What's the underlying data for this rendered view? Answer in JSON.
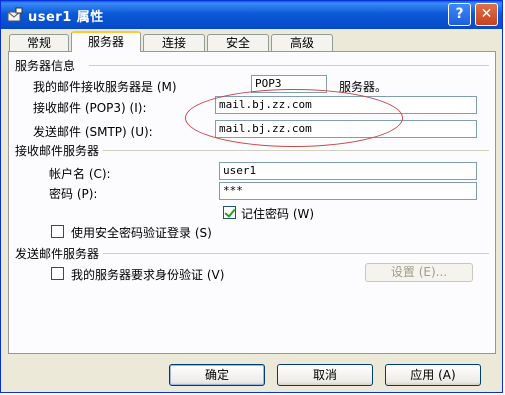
{
  "window": {
    "title": "user1 属性",
    "help_glyph": "?",
    "close_glyph": "✕"
  },
  "tabs": [
    {
      "label": "常规",
      "active": false
    },
    {
      "label": "服务器",
      "active": true
    },
    {
      "label": "连接",
      "active": false
    },
    {
      "label": "安全",
      "active": false
    },
    {
      "label": "高级",
      "active": false
    }
  ],
  "server_info": {
    "group_label": "服务器信息",
    "incoming_type_label": "我的邮件接收服务器是 (M)",
    "incoming_type_value": "POP3",
    "incoming_type_suffix": "服务器。",
    "incoming_label": "接收邮件 (POP3) (I):",
    "incoming_value": "mail.bj.zz.com",
    "outgoing_label": "发送邮件 (SMTP) (U):",
    "outgoing_value": "mail.bj.zz.com"
  },
  "incoming_server": {
    "group_label": "接收邮件服务器",
    "account_label": "帐户名 (C):",
    "account_value": "user1",
    "password_label": "密码 (P):",
    "password_value": "***",
    "remember_label": "记住密码 (W)",
    "remember_checked": true,
    "spa_label": "使用安全密码验证登录 (S)",
    "spa_checked": false
  },
  "outgoing_server": {
    "group_label": "发送邮件服务器",
    "auth_label": "我的服务器要求身份验证 (V)",
    "auth_checked": false,
    "settings_button": "设置 (E)..."
  },
  "buttons": {
    "ok": "确定",
    "cancel": "取消",
    "apply": "应用 (A)"
  },
  "colors": {
    "titlebar": "#0a5ad8",
    "annotation": "#c8484a",
    "tab_highlight": "#ffc83c"
  }
}
